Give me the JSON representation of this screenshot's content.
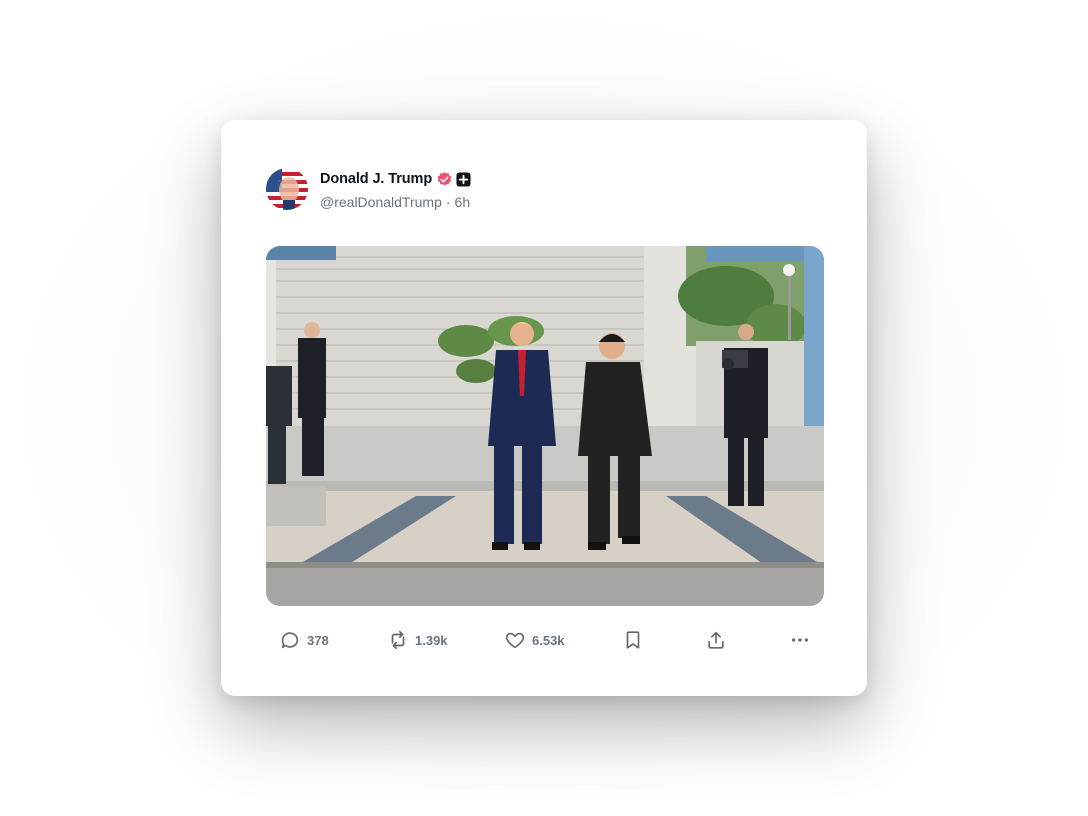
{
  "post": {
    "author": {
      "display_name": "Donald J. Trump",
      "handle": "@realDonaldTrump",
      "time": "6h",
      "separator": "·",
      "verified_color": "#f0506e",
      "affiliate_badge": "plus-badge"
    },
    "media": {
      "description_icon": "photo"
    },
    "actions": {
      "reply_count": "378",
      "retweet_count": "1.39k",
      "like_count": "6.53k"
    }
  },
  "colors": {
    "text_primary": "#0f1419",
    "text_secondary": "#6b7480",
    "card_bg": "#ffffff"
  }
}
